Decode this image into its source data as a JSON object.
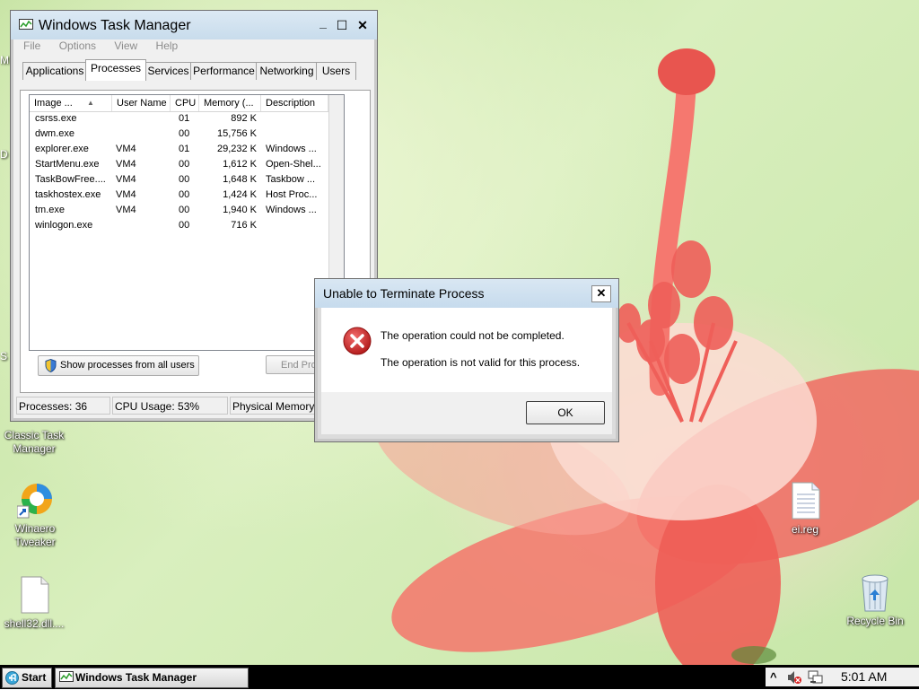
{
  "desktop": {
    "edge_letters": [
      "M",
      "D",
      "S"
    ],
    "icons": [
      {
        "label": "Classic Task Manager",
        "name": "classic-task-manager-icon"
      },
      {
        "label": "Winaero Tweaker",
        "name": "winaero-tweaker-icon"
      },
      {
        "label": "shell32.dll....",
        "name": "shell32-dll-file-icon"
      },
      {
        "label": "ei.reg",
        "name": "ei-reg-file-icon"
      },
      {
        "label": "Recycle Bin",
        "name": "recycle-bin-icon"
      }
    ]
  },
  "task_manager": {
    "title": "Windows Task Manager",
    "minimize_glyph": "_",
    "maximize_glyph": "☐",
    "close_glyph": "✕",
    "menu": [
      "File",
      "Options",
      "View",
      "Help"
    ],
    "tabs": [
      "Applications",
      "Processes",
      "Services",
      "Performance",
      "Networking",
      "Users"
    ],
    "active_tab": "Processes",
    "columns": [
      "Image ...",
      "User Name",
      "CPU",
      "Memory (...",
      "Description"
    ],
    "sort_glyph": "▲",
    "processes": [
      {
        "image": "csrss.exe",
        "user": "",
        "cpu": "01",
        "memory": "892 K",
        "description": ""
      },
      {
        "image": "dwm.exe",
        "user": "",
        "cpu": "00",
        "memory": "15,756 K",
        "description": ""
      },
      {
        "image": "explorer.exe",
        "user": "VM4",
        "cpu": "01",
        "memory": "29,232 K",
        "description": "Windows ..."
      },
      {
        "image": "StartMenu.exe",
        "user": "VM4",
        "cpu": "00",
        "memory": "1,612 K",
        "description": "Open-Shel..."
      },
      {
        "image": "TaskBowFree....",
        "user": "VM4",
        "cpu": "00",
        "memory": "1,648 K",
        "description": "Taskbow ..."
      },
      {
        "image": "taskhostex.exe",
        "user": "VM4",
        "cpu": "00",
        "memory": "1,424 K",
        "description": "Host Proc..."
      },
      {
        "image": "tm.exe",
        "user": "VM4",
        "cpu": "00",
        "memory": "1,940 K",
        "description": "Windows ..."
      },
      {
        "image": "winlogon.exe",
        "user": "",
        "cpu": "00",
        "memory": "716 K",
        "description": ""
      }
    ],
    "show_all_button": "Show processes from all users",
    "end_process_button": "End Pro",
    "status": {
      "processes": "Processes: 36",
      "cpu": "CPU Usage: 53%",
      "memory": "Physical Memory"
    }
  },
  "dialog": {
    "title": "Unable to Terminate Process",
    "close_glyph": "✕",
    "message_1": "The operation could not be completed.",
    "message_2": "The operation is not valid for this process.",
    "ok_label": "OK"
  },
  "taskbar": {
    "start_label": "Start",
    "task_label": "Windows Task Manager",
    "tray_chevron": "^",
    "time": "5:01 AM"
  },
  "colors": {
    "title_bar": "#cfe0ef",
    "error_red": "#c9211e",
    "taskbar": "#000000"
  }
}
